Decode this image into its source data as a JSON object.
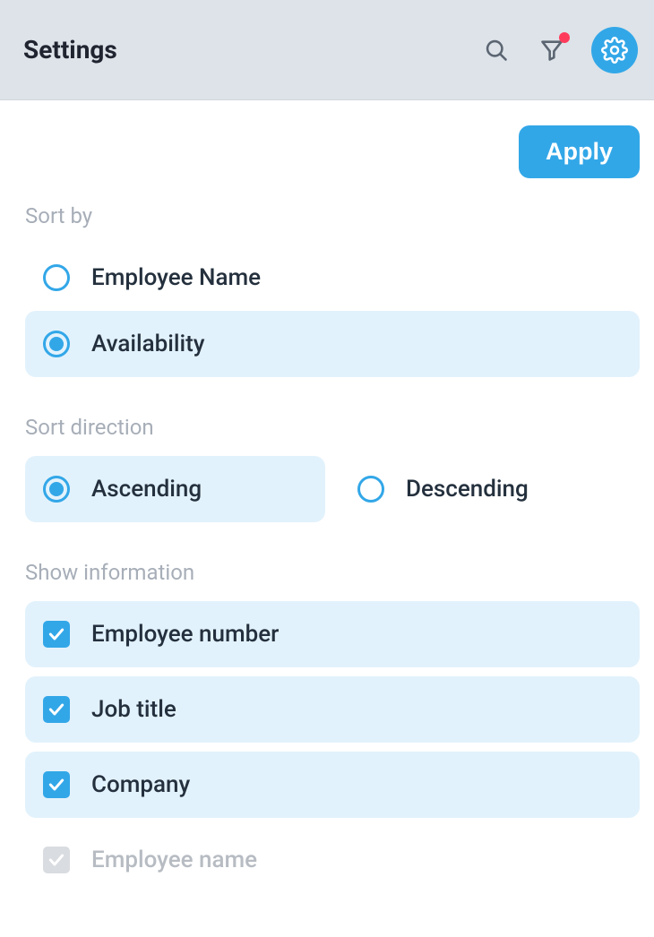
{
  "header": {
    "title": "Settings"
  },
  "actions": {
    "apply_label": "Apply"
  },
  "sections": {
    "sort_by": {
      "label": "Sort by",
      "options": [
        {
          "label": "Employee Name",
          "selected": false
        },
        {
          "label": "Availability",
          "selected": true
        }
      ]
    },
    "sort_direction": {
      "label": "Sort direction",
      "options": [
        {
          "label": "Ascending",
          "selected": true
        },
        {
          "label": "Descending",
          "selected": false
        }
      ]
    },
    "show_information": {
      "label": "Show information",
      "options": [
        {
          "label": "Employee number",
          "checked": true,
          "disabled": false
        },
        {
          "label": "Job title",
          "checked": true,
          "disabled": false
        },
        {
          "label": "Company",
          "checked": true,
          "disabled": false
        },
        {
          "label": "Employee name",
          "checked": true,
          "disabled": true
        }
      ]
    }
  }
}
